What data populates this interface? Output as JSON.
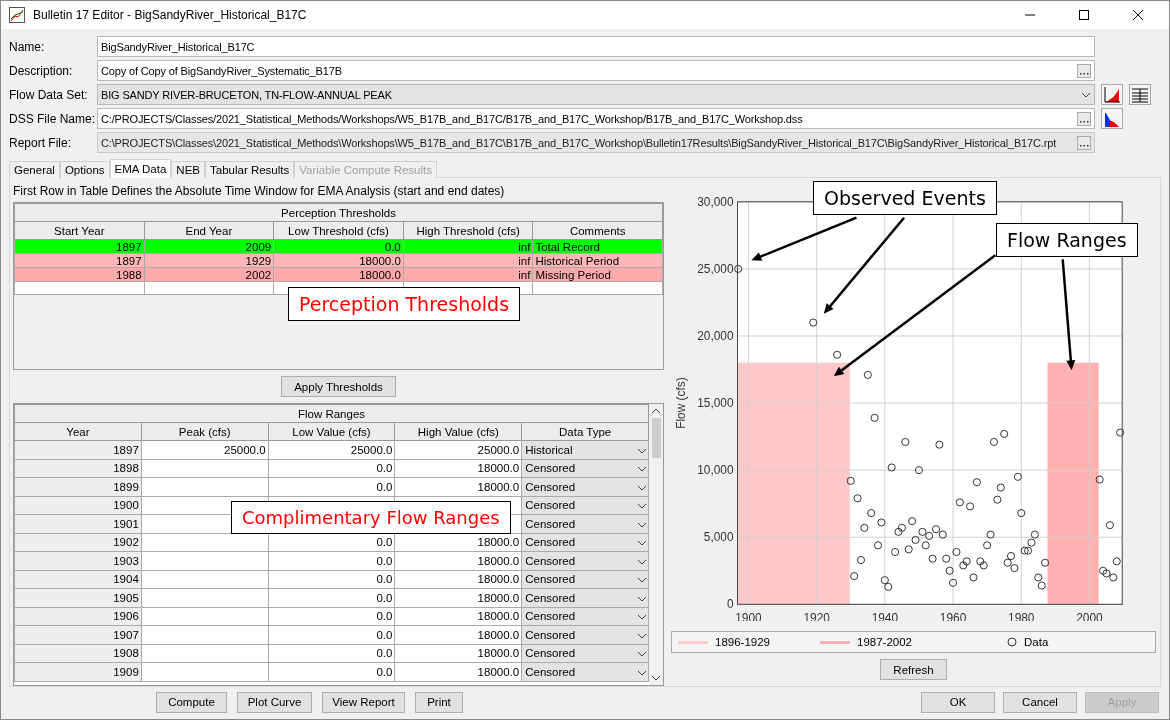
{
  "window": {
    "title": "Bulletin 17 Editor - BigSandyRiver_Historical_B17C"
  },
  "form": {
    "fields": [
      {
        "label": "Name:",
        "kind": "text",
        "readonly": false,
        "value": "BigSandyRiver_Historical_B17C"
      },
      {
        "label": "Description:",
        "kind": "browse",
        "readonly": false,
        "value": "Copy of Copy of BigSandyRiver_Systematic_B17B"
      },
      {
        "label": "Flow Data Set:",
        "kind": "select",
        "readonly": false,
        "value": "BIG SANDY RIVER-BRUCETON, TN-FLOW-ANNUAL PEAK"
      },
      {
        "label": "DSS File Name:",
        "kind": "browse-plot",
        "readonly": false,
        "value": "C:/PROJECTS/Classes/2021_Statistical_Methods/Workshops/W5_B17B_and_B17C/B17B_and_B17C_Workshop/B17B_and_B17C_Workshop.dss"
      },
      {
        "label": "Report File:",
        "kind": "browse",
        "readonly": true,
        "value": "C:\\PROJECTS\\Classes\\2021_Statistical_Methods\\Workshops\\W5_B17B_and_B17C\\B17B_and_B17C_Workshop\\Bulletin17Results\\BigSandyRiver_Historical_B17C\\BigSandyRiver_Historical_B17C.rpt"
      }
    ]
  },
  "tabs": [
    {
      "label": "General",
      "selected": false,
      "disabled": false
    },
    {
      "label": "Options",
      "selected": false,
      "disabled": false
    },
    {
      "label": "EMA Data",
      "selected": true,
      "disabled": false
    },
    {
      "label": "NEB",
      "selected": false,
      "disabled": false
    },
    {
      "label": "Tabular Results",
      "selected": false,
      "disabled": false
    },
    {
      "label": "Variable Compute Results",
      "selected": false,
      "disabled": true
    }
  ],
  "ema_note": "First Row in Table Defines the Absolute Time Window for EMA Analysis (start and end dates)",
  "perception_table": {
    "title": "Perception Thresholds",
    "columns": [
      "Start Year",
      "End Year",
      "Low Threshold (cfs)",
      "High Threshold (cfs)",
      "Comments"
    ],
    "rows": [
      {
        "color": "#00ff00",
        "cells": [
          "1897",
          "2009",
          "0.0",
          "inf",
          "Total Record"
        ]
      },
      {
        "color": "#ffb6b6",
        "cells": [
          "1897",
          "1929",
          "18000.0",
          "inf",
          "Historical Period"
        ]
      },
      {
        "color": "#ffaaaa",
        "cells": [
          "1988",
          "2002",
          "18000.0",
          "inf",
          "Missing Period"
        ]
      }
    ]
  },
  "apply_thresholds": "Apply Thresholds",
  "flow_table": {
    "title": "Flow Ranges",
    "columns": [
      "Year",
      "Peak (cfs)",
      "Low Value (cfs)",
      "High Value (cfs)",
      "Data Type"
    ],
    "rows": [
      {
        "year": "1897",
        "peak": "25000.0",
        "low": "25000.0",
        "high": "25000.0",
        "type": "Historical"
      },
      {
        "year": "1898",
        "low": "0.0",
        "high": "18000.0",
        "type": "Censored"
      },
      {
        "year": "1899",
        "low": "0.0",
        "high": "18000.0",
        "type": "Censored"
      },
      {
        "year": "1900",
        "type": "Censored"
      },
      {
        "year": "1901",
        "type": "Censored"
      },
      {
        "year": "1902",
        "low": "0.0",
        "high": "18000.0",
        "type": "Censored"
      },
      {
        "year": "1903",
        "low": "0.0",
        "high": "18000.0",
        "type": "Censored"
      },
      {
        "year": "1904",
        "low": "0.0",
        "high": "18000.0",
        "type": "Censored"
      },
      {
        "year": "1905",
        "low": "0.0",
        "high": "18000.0",
        "type": "Censored"
      },
      {
        "year": "1906",
        "low": "0.0",
        "high": "18000.0",
        "type": "Censored"
      },
      {
        "year": "1907",
        "low": "0.0",
        "high": "18000.0",
        "type": "Censored"
      },
      {
        "year": "1908",
        "low": "0.0",
        "high": "18000.0",
        "type": "Censored"
      },
      {
        "year": "1909",
        "low": "0.0",
        "high": "18000.0",
        "type": "Censored"
      }
    ]
  },
  "chart": {
    "chart_data": {
      "type": "scatter",
      "grid": true,
      "ylabel": "Flow (cfs)",
      "xlim": [
        1896.8,
        2009.6
      ],
      "ylim": [
        0,
        30000
      ],
      "xticks": [
        1900,
        1920,
        1940,
        1960,
        1980,
        2000
      ],
      "yticks": [
        {
          "value": 0,
          "label": "0"
        },
        {
          "value": 5000,
          "label": "5,000"
        },
        {
          "value": 10000,
          "label": "10,000"
        },
        {
          "value": 15000,
          "label": "15,000"
        },
        {
          "value": 20000,
          "label": "20,000"
        },
        {
          "value": 25000,
          "label": "25,000"
        },
        {
          "value": 30000,
          "label": "30,000"
        }
      ],
      "series": [
        {
          "name": "1896-1929",
          "type": "area",
          "color": "#ffc8c8",
          "x": [
            1896.8,
            1929.7
          ],
          "values": [
            18000,
            18000
          ]
        },
        {
          "name": "1987-2002",
          "type": "area",
          "color": "#ffb0b0",
          "x": [
            1987.7,
            2002.7
          ],
          "values": [
            18000,
            18000
          ]
        },
        {
          "name": "Data",
          "color": "#333333",
          "x": [
            1897,
            1919,
            1926,
            1930,
            1931,
            1932,
            1933,
            1934,
            1935,
            1936,
            1937,
            1938,
            1939,
            1940,
            1941,
            1942,
            1943,
            1944,
            1945,
            1946,
            1947,
            1948,
            1949,
            1950,
            1951,
            1952,
            1953,
            1954,
            1955,
            1956,
            1957,
            1958,
            1959,
            1960,
            1961,
            1962,
            1963,
            1964,
            1965,
            1966,
            1967,
            1968,
            1969,
            1970,
            1971,
            1972,
            1973,
            1974,
            1975,
            1976,
            1977,
            1978,
            1979,
            1980,
            1981,
            1982,
            1983,
            1984,
            1985,
            1986,
            1987,
            2003,
            2004,
            2005,
            2006,
            2007,
            2008,
            2009
          ],
          "values": [
            25000,
            21000,
            18600,
            9200,
            2100,
            7900,
            3300,
            5700,
            17100,
            6800,
            13900,
            4400,
            6100,
            1800,
            1300,
            10200,
            3900,
            5400,
            5700,
            12100,
            4100,
            6200,
            4800,
            10000,
            5400,
            4400,
            5100,
            3400,
            5600,
            11900,
            5200,
            3400,
            2500,
            1600,
            3900,
            7600,
            2900,
            3200,
            7300,
            2000,
            9100,
            3200,
            2900,
            4400,
            5200,
            12100,
            7800,
            8700,
            12700,
            3100,
            3600,
            2700,
            9500,
            6800,
            4000,
            4000,
            4600,
            5200,
            2000,
            1400,
            3100,
            9300,
            2500,
            2300,
            5900,
            2000,
            3200,
            12800
          ]
        }
      ]
    }
  },
  "refresh": "Refresh",
  "callouts": [
    {
      "text": "Perception Thresholds",
      "kind": "red"
    },
    {
      "text": "Complimentary Flow Ranges",
      "kind": "red"
    },
    {
      "text": "Observed Events",
      "kind": "black"
    },
    {
      "text": "Flow Ranges",
      "kind": "black"
    }
  ],
  "bottom_buttons": [
    {
      "label": "Compute",
      "disabled": false
    },
    {
      "label": "Plot Curve",
      "disabled": false
    },
    {
      "label": "View Report",
      "disabled": false
    },
    {
      "label": "Print",
      "disabled": false
    }
  ],
  "dialog_buttons": [
    {
      "label": "OK",
      "disabled": false
    },
    {
      "label": "Cancel",
      "disabled": false
    },
    {
      "label": "Apply",
      "disabled": true
    }
  ]
}
